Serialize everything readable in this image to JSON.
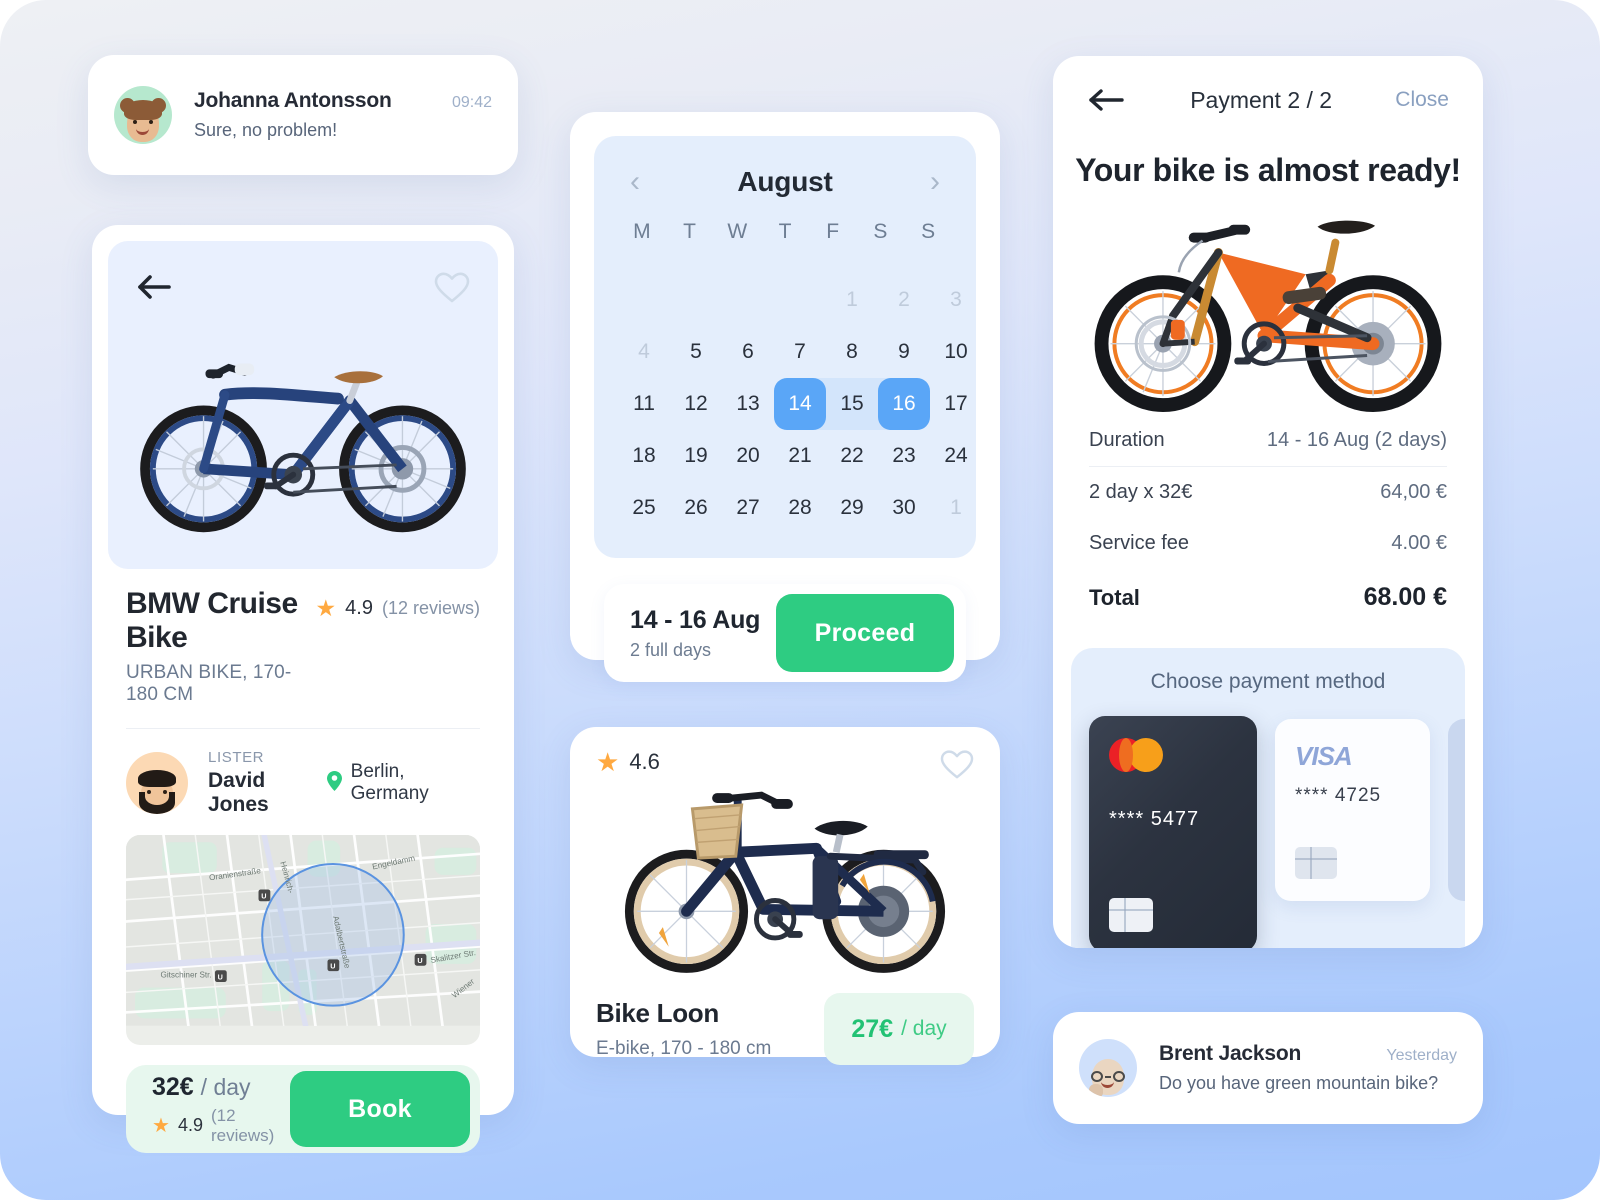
{
  "messages": [
    {
      "name": "Johanna Antonsson",
      "time": "09:42",
      "text": "Sure, no problem!",
      "avatar_icon": "woman-face-avatar"
    },
    {
      "name": "Brent Jackson",
      "time": "Yesterday",
      "text": "Do you have green mountain bike?",
      "avatar_icon": "man-glasses-face-avatar"
    }
  ],
  "detail": {
    "back_icon": "back-arrow-icon",
    "favorite_icon": "heart-icon",
    "bike_image": "blue-urban-bicycle-photo",
    "title": "BMW Cruise Bike",
    "subtitle": "URBAN BIKE, 170-180 CM",
    "rating_value": "4.9",
    "rating_count": "(12 reviews)",
    "lister_label": "LISTER",
    "lister_name": "David Jones",
    "lister_avatar": "bearded-man-avatar",
    "location_icon": "map-pin-icon",
    "location": "Berlin, Germany",
    "map_labels": [
      "Oranienstraße",
      "Heinrich-",
      "Engeldamm",
      "Adalbertstraße",
      "Gitschiner Str.",
      "Skalitzer Str.",
      "Wiener"
    ],
    "price": "32€",
    "price_per": "/ day",
    "book_label": "Book"
  },
  "calendar": {
    "month": "August",
    "prev_icon": "chevron-left-icon",
    "next_icon": "chevron-right-icon",
    "weekdays": [
      "M",
      "T",
      "W",
      "T",
      "F",
      "S",
      "S"
    ],
    "cells": [
      {
        "label": "",
        "state": "empty"
      },
      {
        "label": "",
        "state": "empty"
      },
      {
        "label": "",
        "state": "empty"
      },
      {
        "label": "",
        "state": "empty"
      },
      {
        "label": "1",
        "state": "dim"
      },
      {
        "label": "2",
        "state": "dim"
      },
      {
        "label": "3",
        "state": "dim"
      },
      {
        "label": "4",
        "state": "dim"
      },
      {
        "label": "5",
        "state": "normal"
      },
      {
        "label": "6",
        "state": "normal"
      },
      {
        "label": "7",
        "state": "normal"
      },
      {
        "label": "8",
        "state": "normal"
      },
      {
        "label": "9",
        "state": "normal"
      },
      {
        "label": "10",
        "state": "normal"
      },
      {
        "label": "11",
        "state": "normal"
      },
      {
        "label": "12",
        "state": "normal"
      },
      {
        "label": "13",
        "state": "normal"
      },
      {
        "label": "14",
        "state": "selected-start"
      },
      {
        "label": "15",
        "state": "in-range"
      },
      {
        "label": "16",
        "state": "selected-end"
      },
      {
        "label": "17",
        "state": "normal"
      },
      {
        "label": "18",
        "state": "normal"
      },
      {
        "label": "19",
        "state": "normal"
      },
      {
        "label": "20",
        "state": "normal"
      },
      {
        "label": "21",
        "state": "normal"
      },
      {
        "label": "22",
        "state": "normal"
      },
      {
        "label": "23",
        "state": "normal"
      },
      {
        "label": "24",
        "state": "normal"
      },
      {
        "label": "25",
        "state": "normal"
      },
      {
        "label": "26",
        "state": "normal"
      },
      {
        "label": "27",
        "state": "normal"
      },
      {
        "label": "28",
        "state": "normal"
      },
      {
        "label": "29",
        "state": "normal"
      },
      {
        "label": "30",
        "state": "normal"
      },
      {
        "label": "1",
        "state": "dim"
      }
    ],
    "footer_range": "14 - 16 Aug",
    "footer_days": "2 full days",
    "proceed_label": "Proceed"
  },
  "loon": {
    "rating_value": "4.6",
    "favorite_icon": "heart-icon",
    "bike_image": "navy-e-bike-with-basket-photo",
    "name": "Bike Loon",
    "subtitle": "E-bike, 170 - 180 cm",
    "price": "27€",
    "price_per": "/ day"
  },
  "payment": {
    "back_icon": "back-arrow-icon",
    "step_title": "Payment 2 / 2",
    "close_label": "Close",
    "headline": "Your bike is almost ready!",
    "bike_image": "orange-mountain-bike-photo",
    "rows": [
      {
        "key": "Duration",
        "value": "14 - 16 Aug (2 days)"
      },
      {
        "key": "2 day x 32€",
        "value": "64,00 €"
      },
      {
        "key": "Service fee",
        "value": "4.00 €"
      }
    ],
    "total_key": "Total",
    "total_value": "68.00 €",
    "methods_title": "Choose payment method",
    "cards": [
      {
        "brand": "mastercard",
        "number": "**** 5477",
        "selected": true
      },
      {
        "brand": "visa",
        "brand_label": "VISA",
        "number": "**** 4725",
        "selected": false
      },
      {
        "brand": "hidden",
        "number": "",
        "selected": false
      }
    ]
  },
  "colors": {
    "accent_green": "#2ecc82",
    "accent_blue": "#5aa6f7",
    "star_orange": "#ffa940",
    "price_green": "#22c274"
  }
}
